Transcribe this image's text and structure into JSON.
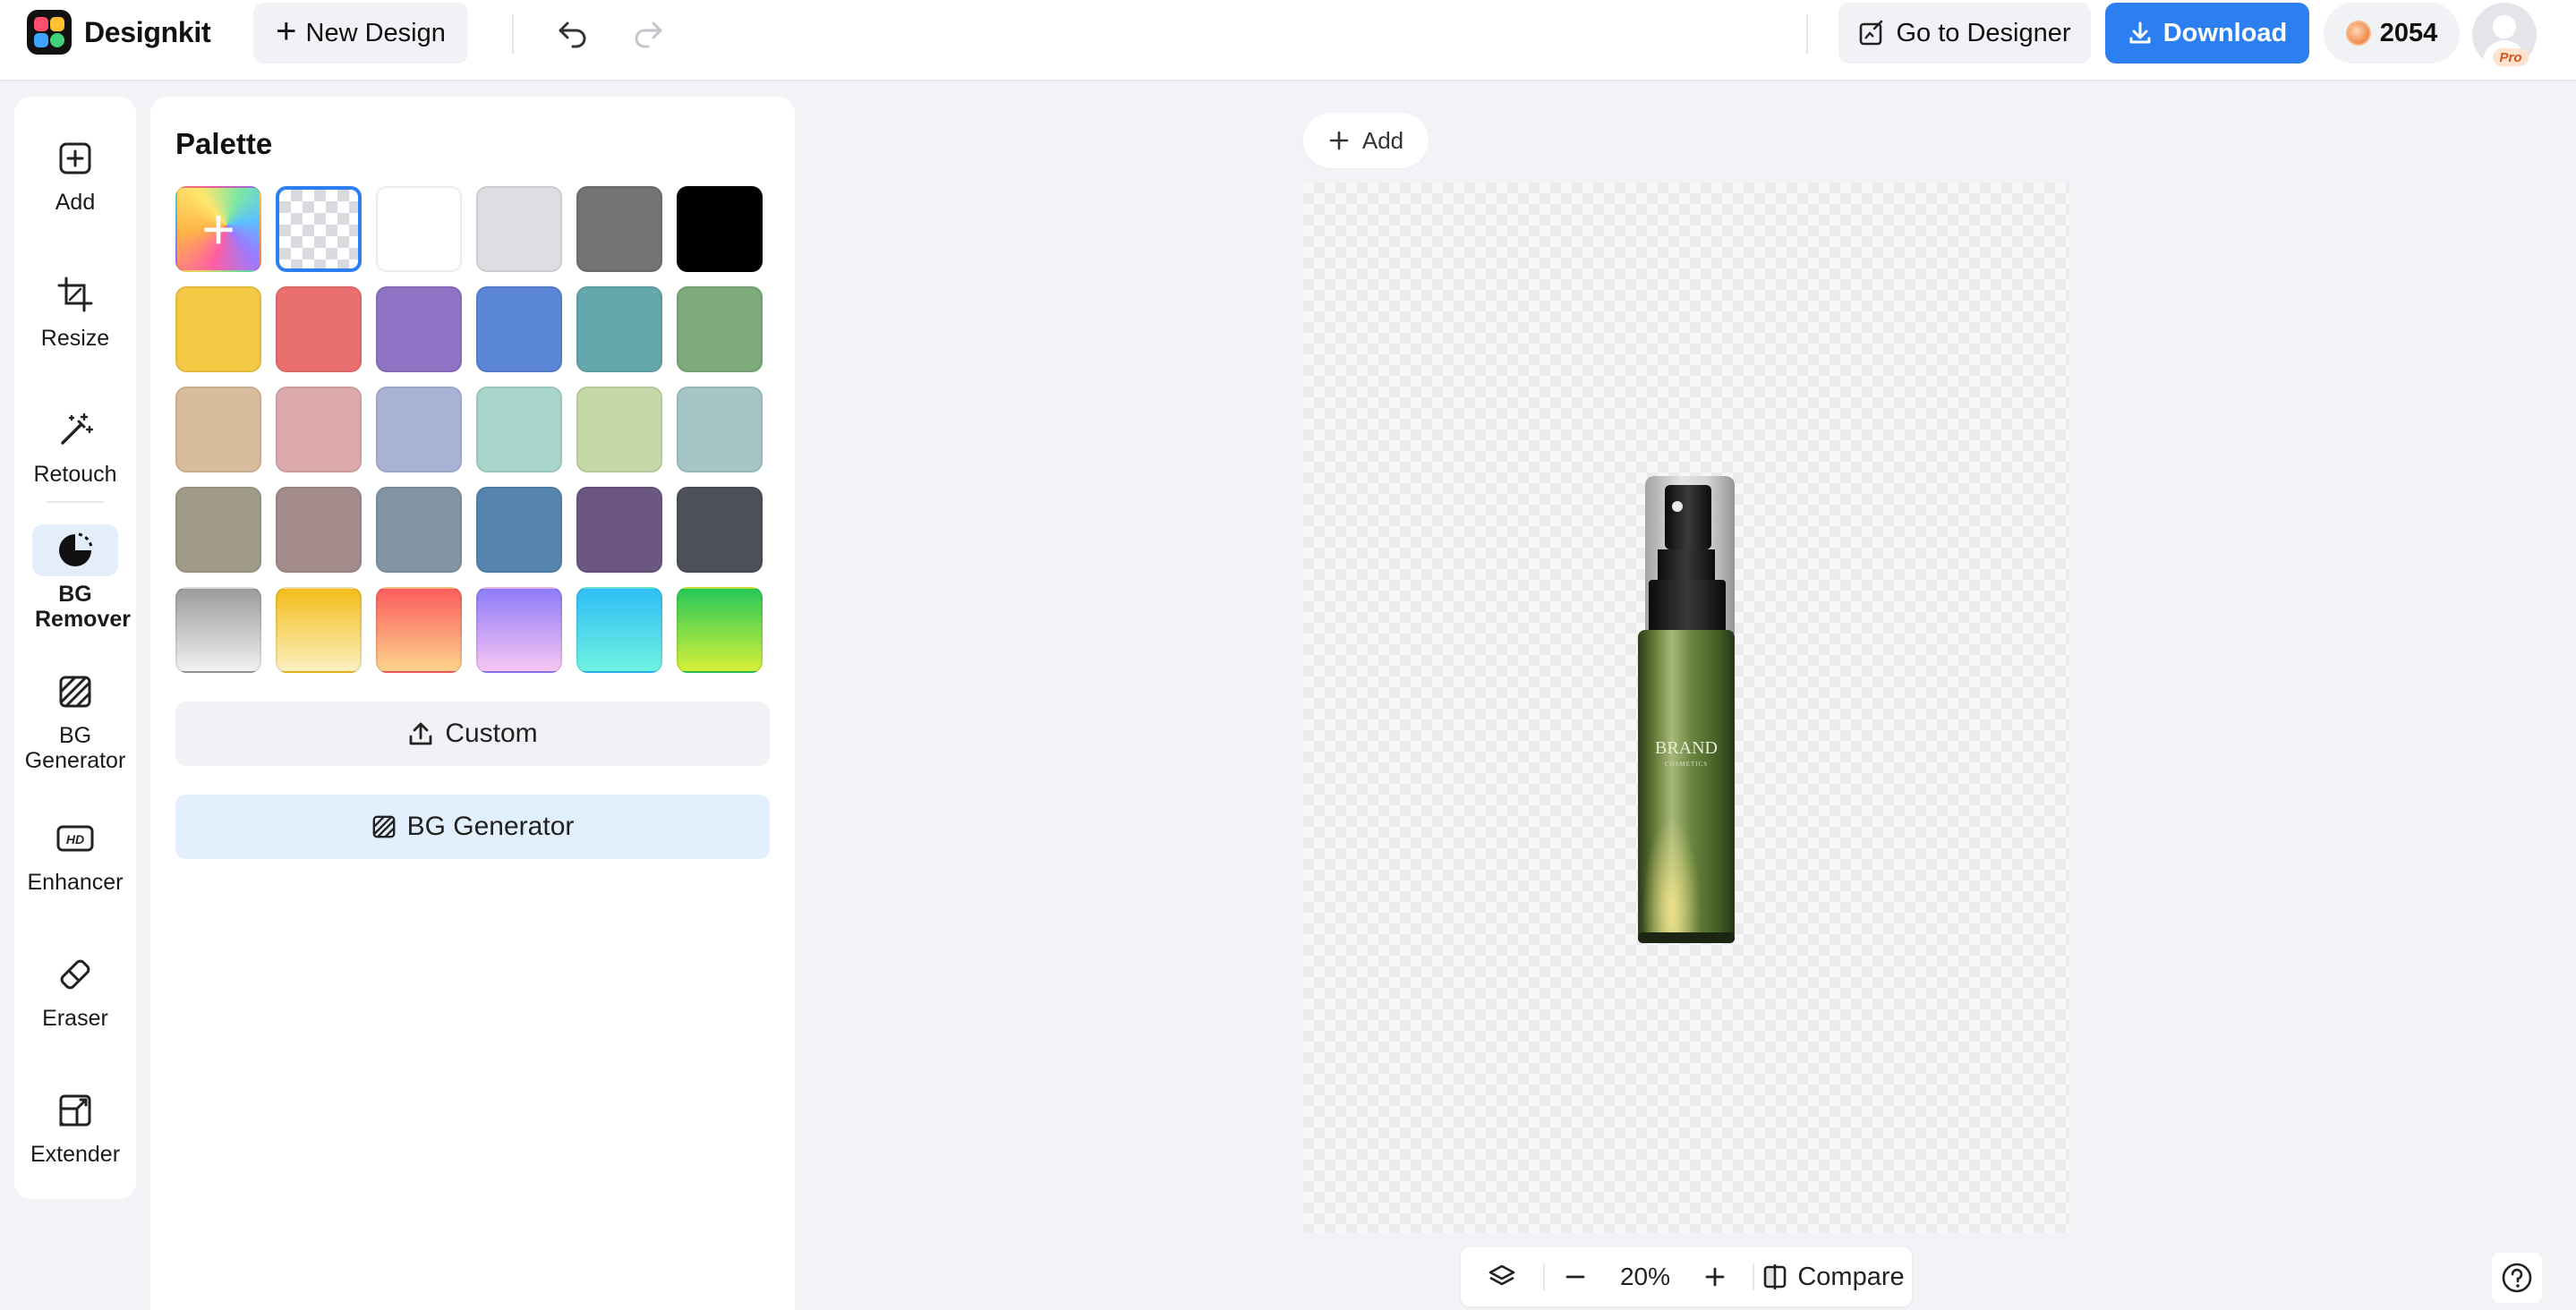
{
  "app": {
    "name": "Designkit"
  },
  "header": {
    "new_design_label": "New Design",
    "go_to_designer_label": "Go to Designer",
    "download_label": "Download",
    "credits": "2054",
    "pro_badge": "Pro"
  },
  "tools": [
    {
      "label": "Add",
      "icon": "add-square-icon"
    },
    {
      "label": "Resize",
      "icon": "crop-icon"
    },
    {
      "label": "Retouch",
      "icon": "magic-wand-icon"
    },
    {
      "label": "BG Remover",
      "icon": "bg-remover-icon",
      "active": true
    },
    {
      "label": "BG Generator",
      "icon": "hatched-square-icon"
    },
    {
      "label": "Enhancer",
      "icon": "hd-icon"
    },
    {
      "label": "Eraser",
      "icon": "eraser-icon"
    },
    {
      "label": "Extender",
      "icon": "extend-frame-icon"
    }
  ],
  "palette": {
    "title": "Palette",
    "selected": "transparent",
    "rows": [
      [
        "custom-rainbow",
        "transparent",
        "#ffffff",
        "#dddee2",
        "#737373",
        "#000000"
      ],
      [
        "#f3c842",
        "#ea7070",
        "#9173c6",
        "#5b87d6",
        "#64a8ac",
        "#7dab7c"
      ],
      [
        "#d9bb9d",
        "#dcaaab",
        "#aab3d5",
        "#a8d5ca",
        "#c4d8a8",
        "#a5c5c7"
      ],
      [
        "#a09a88",
        "#a38c8b",
        "#8395a3",
        "#5584ae",
        "#6b5782",
        "#4e5159"
      ],
      [
        "linear-gradient(180deg,#9b9b9b,#f1f1f1)",
        "linear-gradient(180deg,#f3bd1b,#fbf0c0)",
        "linear-gradient(180deg,#fb5d5d,#fdd38c)",
        "linear-gradient(180deg,#8e7bfa,#f7c6f2)",
        "linear-gradient(180deg,#2fbef6,#6ff2e1)",
        "linear-gradient(180deg,#27c858,#d7f03a)"
      ]
    ],
    "custom_label": "Custom",
    "bg_generator_label": "BG Generator"
  },
  "canvas": {
    "add_label": "Add",
    "product_brand": "BRAND",
    "product_sub": "COSMETICS"
  },
  "zoom": {
    "value": "20%",
    "compare_label": "Compare"
  },
  "colors": {
    "accent": "#2b7ff0",
    "active_tool_bg": "#e4eefb"
  }
}
